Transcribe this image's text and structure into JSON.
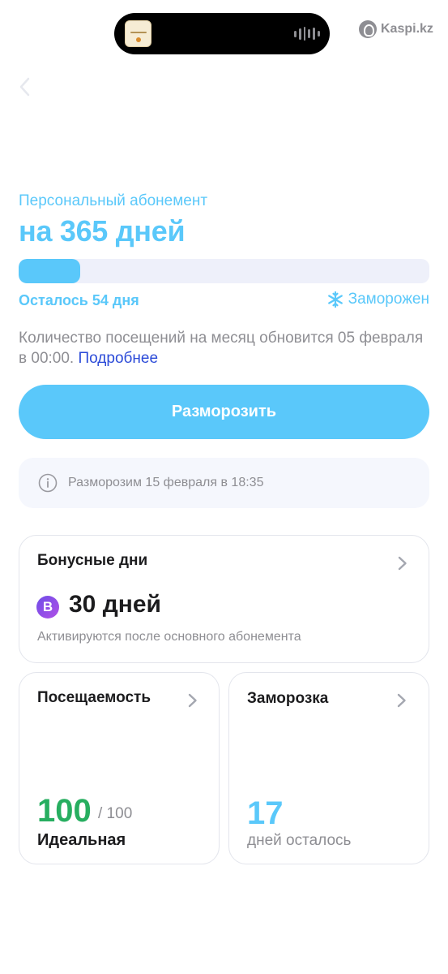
{
  "status_bar": {
    "watermark": "Kaspi.kz"
  },
  "subscription": {
    "subtitle": "Персональный абонемент",
    "title": "на 365 дней",
    "progress_fraction": 0.15,
    "remaining": "Осталось 54 дня",
    "status": "Заморожен",
    "update_info": "Количество посещений на месяц обновится 05 февраля в 00:00.",
    "more_link": "Подробнее"
  },
  "actions": {
    "unfreeze_label": "Разморозить"
  },
  "notice": {
    "text": "Разморозим 15 февраля в 18:35"
  },
  "bonus_card": {
    "title": "Бонусные дни",
    "badge": "B",
    "value": "30 дней",
    "caption": "Активируются после основного абонемента"
  },
  "visits_card": {
    "title": "Посещаемость",
    "value": "100",
    "total": "/ 100",
    "label": "Идеальная"
  },
  "freeze_card": {
    "title": "Заморозка",
    "value": "17",
    "label": "дней осталось"
  },
  "colors": {
    "accent": "#5ac8fa",
    "link": "#2c4bd8",
    "success": "#27ae60",
    "muted": "#8e8e93"
  }
}
